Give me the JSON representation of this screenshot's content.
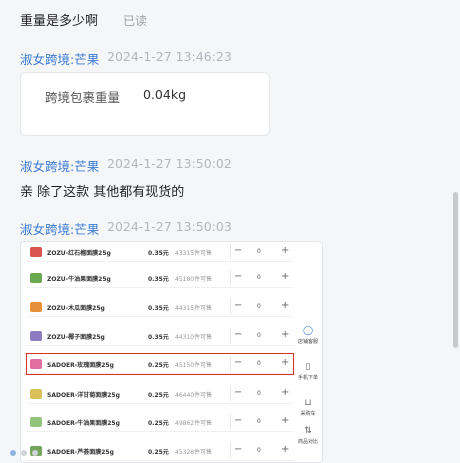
{
  "messages": {
    "m1": {
      "text": "重量是多少啊",
      "status": "已读"
    },
    "m2": {
      "sender": "淑女跨境:芒果",
      "time": "2024-1-27 13:46:23",
      "card": {
        "label": "跨境包裹重量",
        "value": "0.04kg"
      }
    },
    "m3": {
      "sender": "淑女跨境:芒果",
      "time": "2024-1-27 13:50:02",
      "text": "亲 除了这款 其他都有现货的"
    },
    "m4": {
      "sender": "淑女跨境:芒果",
      "time": "2024-1-27 13:50:03"
    }
  },
  "screenshot": {
    "rows": [
      {
        "name": "ZOZU-红石榴面膜25g",
        "price": "0.35元",
        "stock": "43315件可售",
        "qty": "0",
        "color": "#d9534f"
      },
      {
        "name": "ZOZU-牛油果面膜25g",
        "price": "0.35元",
        "stock": "45180件可售",
        "qty": "0",
        "color": "#6aa84f"
      },
      {
        "name": "ZOZU-木瓜面膜25g",
        "price": "0.35元",
        "stock": "44315件可售",
        "qty": "0",
        "color": "#e69138"
      },
      {
        "name": "ZOZU-椰子面膜25g",
        "price": "0.35元",
        "stock": "44310件可售",
        "qty": "0",
        "color": "#8e7cc3"
      },
      {
        "name": "SADOER-玫瑰面膜25g",
        "price": "0.25元",
        "stock": "45150件可售",
        "qty": "0",
        "color": "#e06fa0",
        "highlight": true
      },
      {
        "name": "SADOER-洋甘菊面膜25g",
        "price": "0.25元",
        "stock": "46440件可售",
        "qty": "0",
        "color": "#d9c15a"
      },
      {
        "name": "SADOER-牛油果面膜25g",
        "price": "0.25元",
        "stock": "49862件可售",
        "qty": "0",
        "color": "#93c47d"
      },
      {
        "name": "SADOER-芦荟面膜25g",
        "price": "0.25元",
        "stock": "45328件可售",
        "qty": "0",
        "color": "#76a55c"
      }
    ],
    "side_tools": [
      {
        "label": "店铺客服",
        "icon": "chat-icon"
      },
      {
        "label": "手机下单",
        "icon": "phone-icon"
      },
      {
        "label": "采购车",
        "icon": "cart-icon"
      },
      {
        "label": "商品对比",
        "icon": "compare-icon"
      }
    ]
  }
}
